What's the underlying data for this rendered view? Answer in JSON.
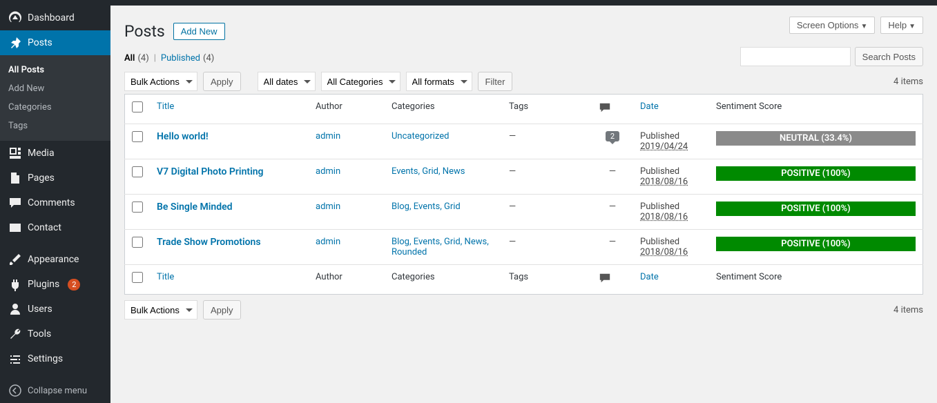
{
  "sidebar": {
    "items": [
      {
        "id": "dashboard",
        "label": "Dashboard"
      },
      {
        "id": "posts",
        "label": "Posts",
        "current": true
      },
      {
        "id": "media",
        "label": "Media"
      },
      {
        "id": "pages",
        "label": "Pages"
      },
      {
        "id": "comments",
        "label": "Comments"
      },
      {
        "id": "contact",
        "label": "Contact"
      },
      {
        "id": "appearance",
        "label": "Appearance"
      },
      {
        "id": "plugins",
        "label": "Plugins",
        "badge": "2"
      },
      {
        "id": "users",
        "label": "Users"
      },
      {
        "id": "tools",
        "label": "Tools"
      },
      {
        "id": "settings",
        "label": "Settings"
      }
    ],
    "submenu": [
      {
        "label": "All Posts",
        "current": true
      },
      {
        "label": "Add New"
      },
      {
        "label": "Categories"
      },
      {
        "label": "Tags"
      }
    ],
    "collapse_label": "Collapse menu"
  },
  "top": {
    "screen_options": "Screen Options",
    "help": "Help"
  },
  "header": {
    "title": "Posts",
    "add_new": "Add New"
  },
  "filters": {
    "all": "All",
    "all_count": "(4)",
    "published": "Published",
    "published_count": "(4)",
    "bulk_actions": "Bulk Actions",
    "apply": "Apply",
    "all_dates": "All dates",
    "all_categories": "All Categories",
    "all_formats": "All formats",
    "filter": "Filter",
    "search_posts": "Search Posts",
    "items_count": "4 items"
  },
  "columns": {
    "title": "Title",
    "author": "Author",
    "categories": "Categories",
    "tags": "Tags",
    "date": "Date",
    "sentiment": "Sentiment Score"
  },
  "rows": [
    {
      "title": "Hello world!",
      "author": "admin",
      "categories": "Uncategorized",
      "tags": "—",
      "comments": "2",
      "date_status": "Published",
      "date": "2019/04/24",
      "sentiment": "NEUTRAL (33.4%)",
      "sentiment_class": "neutral"
    },
    {
      "title": "V7 Digital Photo Printing",
      "author": "admin",
      "categories": "Events, Grid, News",
      "tags": "—",
      "comments": "—",
      "date_status": "Published",
      "date": "2018/08/16",
      "sentiment": "POSITIVE (100%)",
      "sentiment_class": "positive"
    },
    {
      "title": "Be Single Minded",
      "author": "admin",
      "categories": "Blog, Events, Grid",
      "tags": "—",
      "comments": "—",
      "date_status": "Published",
      "date": "2018/08/16",
      "sentiment": "POSITIVE (100%)",
      "sentiment_class": "positive"
    },
    {
      "title": "Trade Show Promotions",
      "author": "admin",
      "categories": "Blog, Events, Grid, News, Rounded",
      "tags": "—",
      "comments": "—",
      "date_status": "Published",
      "date": "2018/08/16",
      "sentiment": "POSITIVE (100%)",
      "sentiment_class": "positive"
    }
  ]
}
